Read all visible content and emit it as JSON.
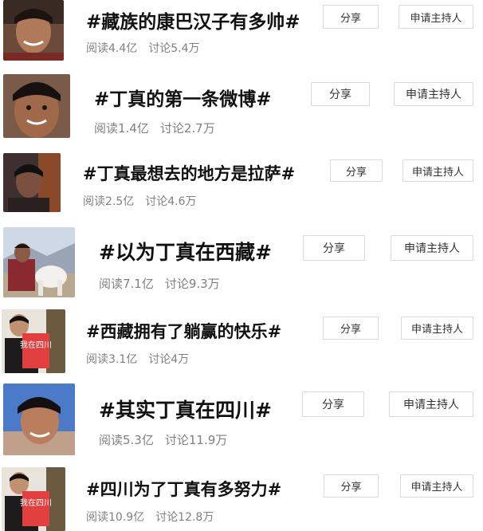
{
  "topics": [
    {
      "title": "#藏族的康巴汉子有多帅#",
      "read": "阅读4.4亿",
      "discuss": "讨论5.4万",
      "share": "分享",
      "host": "申请主持人",
      "thumb_icon": "portrait-smiling-icon"
    },
    {
      "title": "#丁真的第一条微博#",
      "read": "阅读1.4亿",
      "discuss": "讨论2.7万",
      "share": "分享",
      "host": "申请主持人",
      "thumb_icon": "portrait-closeup-icon"
    },
    {
      "title": "#丁真最想去的地方是拉萨#",
      "read": "阅读2.5亿",
      "discuss": "讨论4.6万",
      "share": "分享",
      "host": "申请主持人",
      "thumb_icon": "portrait-dark-icon"
    },
    {
      "title": "#以为丁真在西藏#",
      "read": "阅读7.1亿",
      "discuss": "讨论9.3万",
      "share": "分享",
      "host": "申请主持人",
      "thumb_icon": "horse-rider-icon"
    },
    {
      "title": "#西藏拥有了躺赢的快乐#",
      "read": "阅读3.1亿",
      "discuss": "讨论4万",
      "share": "分享",
      "host": "申请主持人",
      "thumb_icon": "sign-holder-icon"
    },
    {
      "title": "#其实丁真在四川#",
      "read": "阅读5.3亿",
      "discuss": "讨论11.9万",
      "share": "分享",
      "host": "申请主持人",
      "thumb_icon": "portrait-sky-icon"
    },
    {
      "title": "#四川为了丁真有多努力#",
      "read": "阅读10.9亿",
      "discuss": "讨论12.8万",
      "share": "分享",
      "host": "申请主持人",
      "thumb_icon": "sign-holder-icon"
    }
  ],
  "sign_text": "我在四川"
}
